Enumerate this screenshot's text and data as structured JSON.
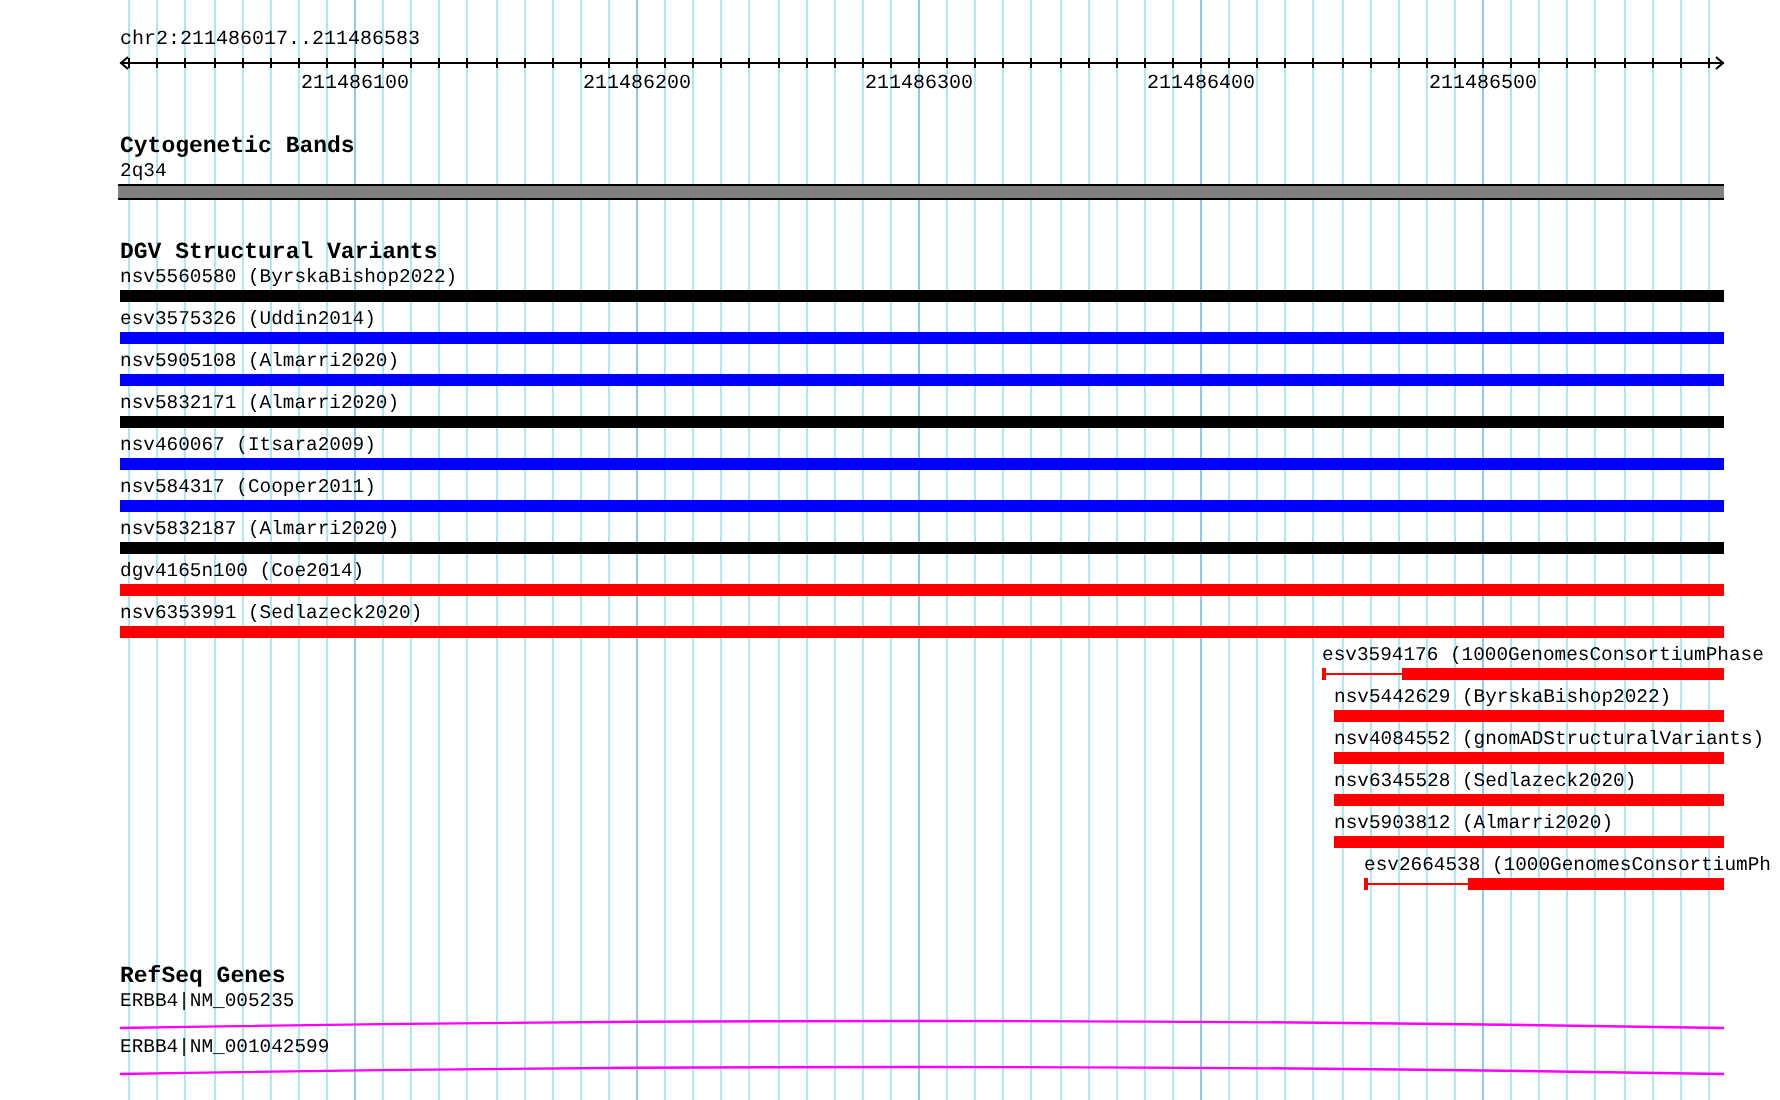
{
  "ruler": {
    "location": "chr2:211486017..211486583",
    "tick_labels": [
      "211486100",
      "211486200",
      "211486300",
      "211486400",
      "211486500"
    ]
  },
  "tracks": [
    {
      "kind": "cytobands",
      "title": "Cytogenetic Bands",
      "features": [
        {
          "label": "2q34"
        }
      ]
    },
    {
      "kind": "variants",
      "title": "DGV Structural Variants",
      "features": [
        {
          "label": "nsv5560580 (ByrskaBishop2022)",
          "color": "#000000",
          "kind": "block"
        },
        {
          "label": "esv3575326 (Uddin2014)",
          "color": "#0000ff",
          "kind": "block"
        },
        {
          "label": "nsv5905108 (Almarri2020)",
          "color": "#0000ff",
          "kind": "block"
        },
        {
          "label": "nsv5832171 (Almarri2020)",
          "color": "#000000",
          "kind": "block"
        },
        {
          "label": "nsv460067 (Itsara2009)",
          "color": "#0000ff",
          "kind": "block"
        },
        {
          "label": "nsv584317 (Cooper2011)",
          "color": "#0000ff",
          "kind": "block"
        },
        {
          "label": "nsv5832187 (Almarri2020)",
          "color": "#000000",
          "kind": "block"
        },
        {
          "label": "dgv4165n100 (Coe2014)",
          "color": "#ff0000",
          "kind": "block"
        },
        {
          "label": "nsv6353991 (Sedlazeck2020)",
          "color": "#ff0000",
          "kind": "block"
        },
        {
          "label": "esv3594176 (1000GenomesConsortiumPhase",
          "color": "#ff0000",
          "kind": "split"
        },
        {
          "label": "nsv5442629 (ByrskaBishop2022)",
          "color": "#ff0000",
          "kind": "block"
        },
        {
          "label": "nsv4084552 (gnomADStructuralVariants)",
          "color": "#ff0000",
          "kind": "block"
        },
        {
          "label": "nsv6345528 (Sedlazeck2020)",
          "color": "#ff0000",
          "kind": "block"
        },
        {
          "label": "nsv5903812 (Almarri2020)",
          "color": "#ff0000",
          "kind": "block"
        },
        {
          "label": "esv2664538 (1000GenomesConsortiumPh",
          "color": "#ff0000",
          "kind": "split"
        }
      ]
    },
    {
      "kind": "genes",
      "title": "RefSeq Genes",
      "features": [
        {
          "label": "ERBB4|NM_005235"
        },
        {
          "label": "ERBB4|NM_001042599"
        }
      ]
    }
  ]
}
